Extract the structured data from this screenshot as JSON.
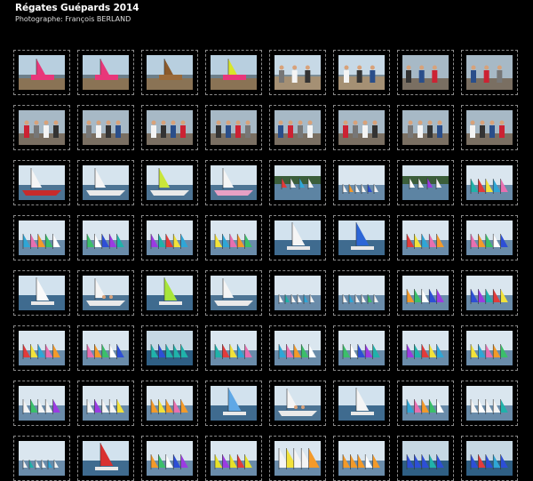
{
  "gallery": {
    "title": "Régates Guépards 2014",
    "photographer": "Photographe: François BERLAND"
  },
  "colors": {
    "background": "#000000",
    "cell_border": "#8a8a8a",
    "sky": "#c9dbe8",
    "water": "#4e6f8e"
  },
  "thumbnails": [
    {
      "kind": "dock-pink"
    },
    {
      "kind": "dock-pink"
    },
    {
      "kind": "dock-brown"
    },
    {
      "kind": "dock-yellow"
    },
    {
      "kind": "dock-people"
    },
    {
      "kind": "dock-boat"
    },
    {
      "kind": "people-table"
    },
    {
      "kind": "people-table"
    },
    {
      "kind": "people"
    },
    {
      "kind": "people"
    },
    {
      "kind": "people"
    },
    {
      "kind": "people"
    },
    {
      "kind": "people"
    },
    {
      "kind": "people"
    },
    {
      "kind": "people"
    },
    {
      "kind": "people"
    },
    {
      "kind": "boat-red"
    },
    {
      "kind": "boat-white"
    },
    {
      "kind": "boat-green"
    },
    {
      "kind": "boat-pink"
    },
    {
      "kind": "sails-trees"
    },
    {
      "kind": "sails-far"
    },
    {
      "kind": "sails-trees"
    },
    {
      "kind": "sails-many"
    },
    {
      "kind": "sails-colorful"
    },
    {
      "kind": "sails-colorful"
    },
    {
      "kind": "sails-colorful"
    },
    {
      "kind": "sails-colorful"
    },
    {
      "kind": "sail-big"
    },
    {
      "kind": "sail-blue"
    },
    {
      "kind": "sails-colorful"
    },
    {
      "kind": "sails-colorful"
    },
    {
      "kind": "sail-white"
    },
    {
      "kind": "boat-people"
    },
    {
      "kind": "sail-green"
    },
    {
      "kind": "boat-close"
    },
    {
      "kind": "sails-far"
    },
    {
      "kind": "sails-far"
    },
    {
      "kind": "sails-colorful"
    },
    {
      "kind": "sails-colorful"
    },
    {
      "kind": "sails-colorful"
    },
    {
      "kind": "sails-colorful"
    },
    {
      "kind": "sails-teal"
    },
    {
      "kind": "sails-colorful"
    },
    {
      "kind": "sails-colorful"
    },
    {
      "kind": "sails-colorful"
    },
    {
      "kind": "sails-colorful"
    },
    {
      "kind": "sails-colorful"
    },
    {
      "kind": "sails-white"
    },
    {
      "kind": "sails-white"
    },
    {
      "kind": "sails-orange"
    },
    {
      "kind": "sail-blue-small"
    },
    {
      "kind": "boat-people"
    },
    {
      "kind": "sail-tilt"
    },
    {
      "kind": "sails-colorful"
    },
    {
      "kind": "sails-white"
    },
    {
      "kind": "sails-far"
    },
    {
      "kind": "sail-red-big"
    },
    {
      "kind": "sails-colorful"
    },
    {
      "kind": "sails-yellow"
    },
    {
      "kind": "sails-white-big"
    },
    {
      "kind": "sails-orange"
    },
    {
      "kind": "sails-blue"
    },
    {
      "kind": "sails-blue"
    }
  ]
}
